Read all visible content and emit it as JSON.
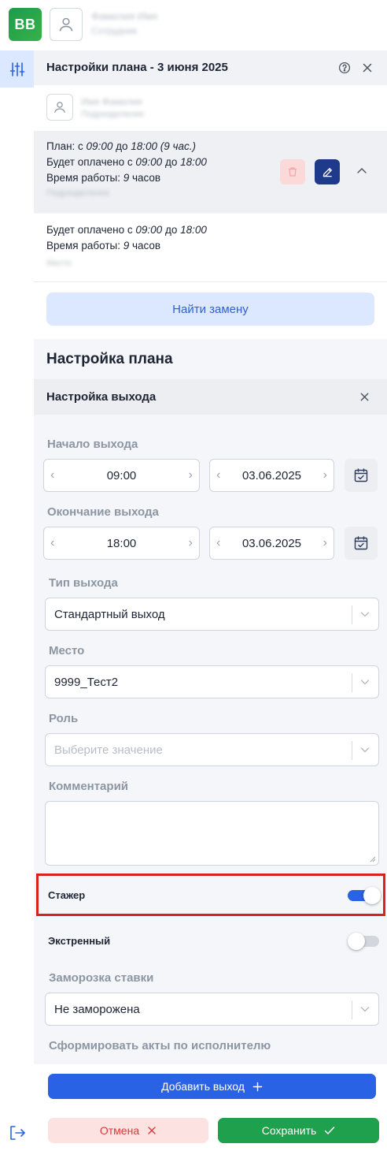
{
  "app": {
    "logo_text": "BB",
    "user_name": "Фамилия Имя",
    "user_sub": "Сотрудник"
  },
  "header": {
    "title": "Настройки плана - 3 июня 2025"
  },
  "employee": {
    "name": "Имя Фамилия",
    "sub": "Подразделение"
  },
  "shift_1": {
    "plan_prefix": "План: с ",
    "plan_from": "09:00",
    "plan_mid": " до ",
    "plan_to": "18:00",
    "plan_hours": " (9 час.)",
    "paid_prefix": "Будет оплачено с ",
    "paid_from": "09:00",
    "paid_mid": " до ",
    "paid_to": "18:00",
    "work_prefix": "Время работы: ",
    "work_hours": "9",
    "work_suffix": " часов",
    "extra": "Подразделение"
  },
  "shift_2": {
    "paid_prefix": "Будет оплачено с ",
    "paid_from": "09:00",
    "paid_mid": " до ",
    "paid_to": "18:00",
    "work_prefix": "Время работы: ",
    "work_hours": "9",
    "work_suffix": " часов",
    "extra": "Место"
  },
  "find_replacement_label": "Найти замену",
  "plan_settings_title": "Настройка плана",
  "exit_settings_title": "Настройка выхода",
  "form": {
    "start_label": "Начало выхода",
    "start_time": "09:00",
    "start_date": "03.06.2025",
    "end_label": "Окончание выхода",
    "end_time": "18:00",
    "end_date": "03.06.2025",
    "type_label": "Тип выхода",
    "type_value": "Стандартный выход",
    "place_label": "Место",
    "place_value": "9999_Тест2",
    "role_label": "Роль",
    "role_placeholder": "Выберите значение",
    "comment_label": "Комментарий",
    "intern_label": "Стажер",
    "intern_on": true,
    "emergency_label": "Экстренный",
    "emergency_on": false,
    "freeze_label": "Заморозка ставки",
    "freeze_value": "Не заморожена",
    "acts_label": "Сформировать акты по исполнителю"
  },
  "buttons": {
    "add_exit": "Добавить выход",
    "cancel": "Отмена",
    "save": "Сохранить"
  },
  "colors": {
    "primary": "#2a62e6",
    "success": "#1fa04c",
    "danger": "#d63a3a",
    "highlight": "#d9221c"
  }
}
